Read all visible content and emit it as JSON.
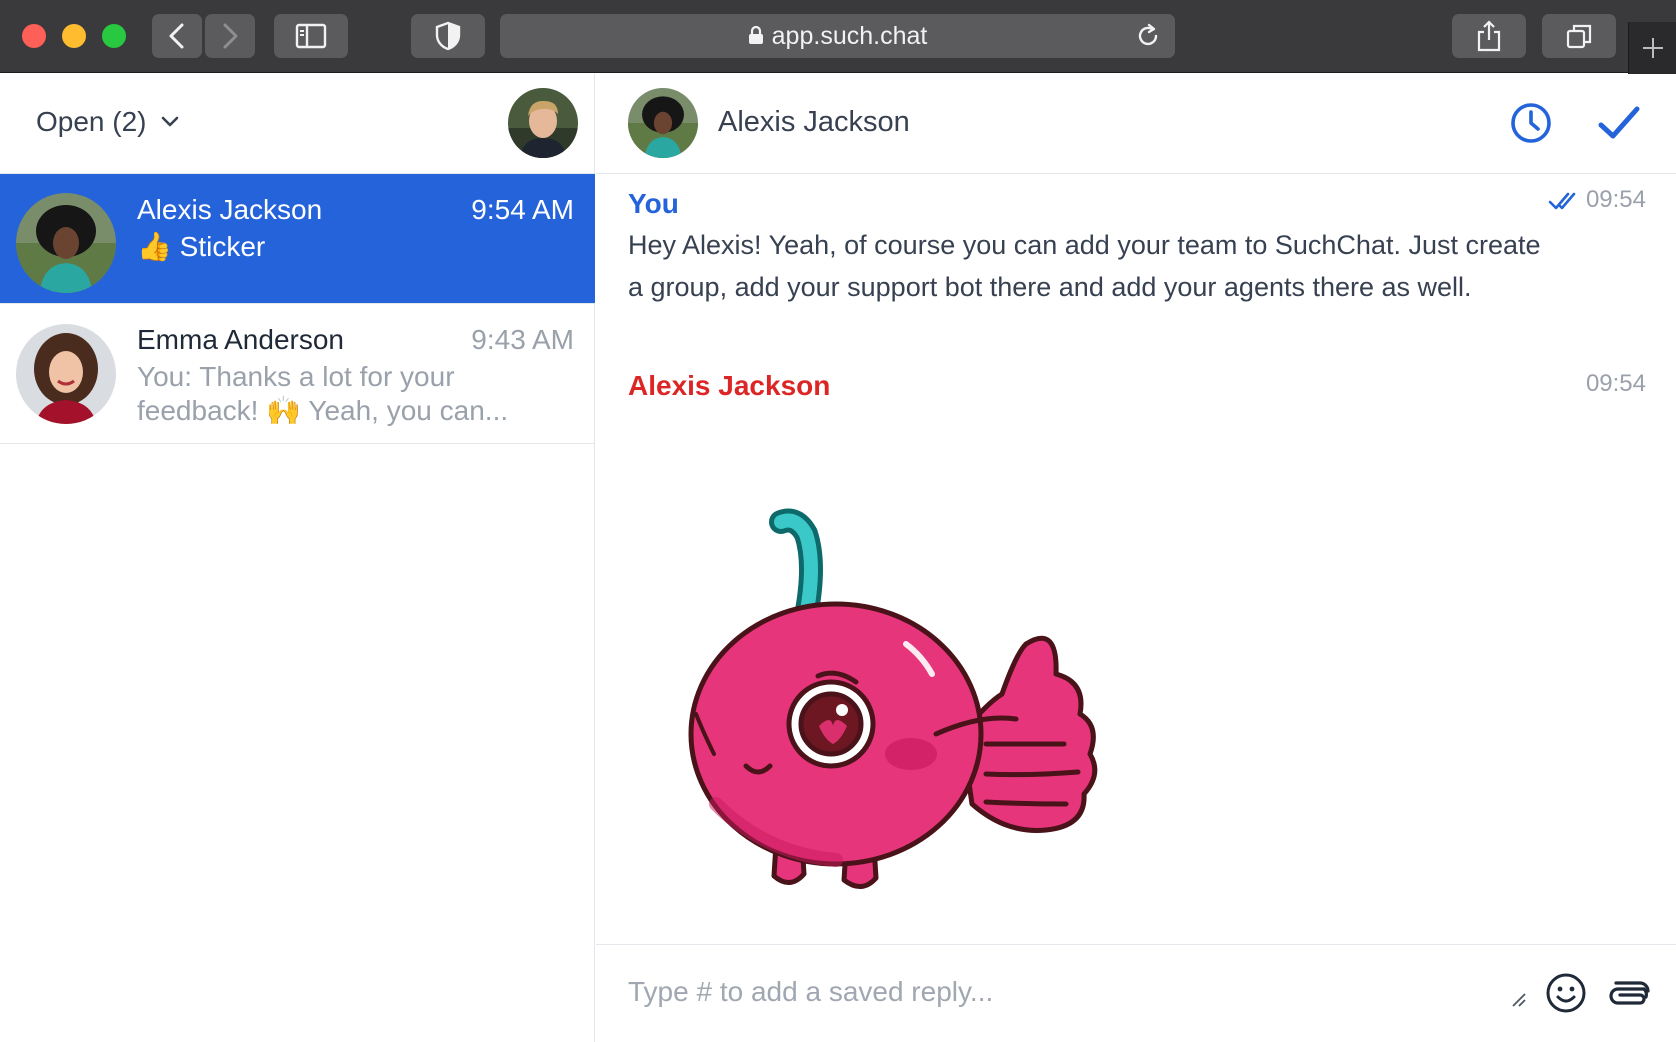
{
  "browser": {
    "url": "app.such.chat"
  },
  "sidebar": {
    "filter_label": "Open (2)",
    "conversations": [
      {
        "name": "Alexis Jackson",
        "time": "9:54 AM",
        "preview_emoji": "👍",
        "preview": "Sticker"
      },
      {
        "name": "Emma Anderson",
        "time": "9:43 AM",
        "preview_line1": "You: Thanks a lot for your",
        "preview_line2a": "feedback! ",
        "preview_emoji": "🙌",
        "preview_line2b": " Yeah, you can..."
      }
    ]
  },
  "chat": {
    "title": "Alexis Jackson",
    "messages": [
      {
        "author": "You",
        "time": "09:54",
        "text": "Hey Alexis! Yeah, of course you can add your team to SuchChat. Just create a group, add your support bot there and add your agents there as well."
      },
      {
        "author": "Alexis Jackson",
        "time": "09:54"
      }
    ],
    "composer_placeholder": "Type # to add a saved reply..."
  },
  "colors": {
    "accent": "#2463d9",
    "contact_name": "#dc2626",
    "sticker_body": "#e6357a"
  }
}
